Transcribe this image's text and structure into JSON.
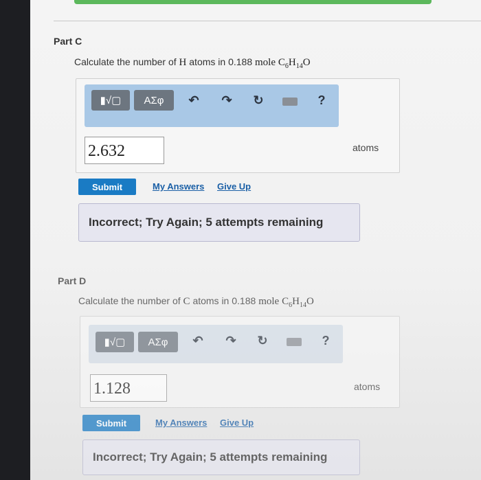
{
  "part_c": {
    "title": "Part C",
    "question_prefix": "Calculate the number of",
    "element": "H",
    "question_mid": "atoms in",
    "amount": "0.188",
    "unit_mole": "mole",
    "formula": {
      "c": "C",
      "c_sub": "6",
      "h": "H",
      "h_sub": "14",
      "o": "O"
    },
    "toolbar": {
      "template_label": "▮√▢",
      "symbols_label": "ΑΣφ",
      "help_label": "?"
    },
    "answer_value": "2.632",
    "units": "atoms",
    "submit_label": "Submit",
    "my_answers_label": "My Answers",
    "give_up_label": "Give Up",
    "feedback": "Incorrect; Try Again; 5 attempts remaining"
  },
  "part_d": {
    "title": "Part D",
    "question_prefix": "Calculate the number of",
    "element": "C",
    "question_mid": "atoms in",
    "amount": "0.188",
    "unit_mole": "mole",
    "formula": {
      "c": "C",
      "c_sub": "6",
      "h": "H",
      "h_sub": "14",
      "o": "O"
    },
    "toolbar": {
      "template_label": "▮√▢",
      "symbols_label": "ΑΣφ",
      "help_label": "?"
    },
    "answer_value": "1.128",
    "units": "atoms",
    "submit_label": "Submit",
    "my_answers_label": "My Answers",
    "give_up_label": "Give Up",
    "feedback": "Incorrect; Try Again; 5 attempts remaining"
  },
  "icons": [
    "undo-icon",
    "redo-icon",
    "reset-icon",
    "keyboard-icon",
    "help-icon"
  ],
  "colors": {
    "toolbar": "#a9c8e6",
    "submit": "#1a7bc4",
    "link": "#1a5fa6",
    "feedback_bg": "#e6e6f0"
  }
}
